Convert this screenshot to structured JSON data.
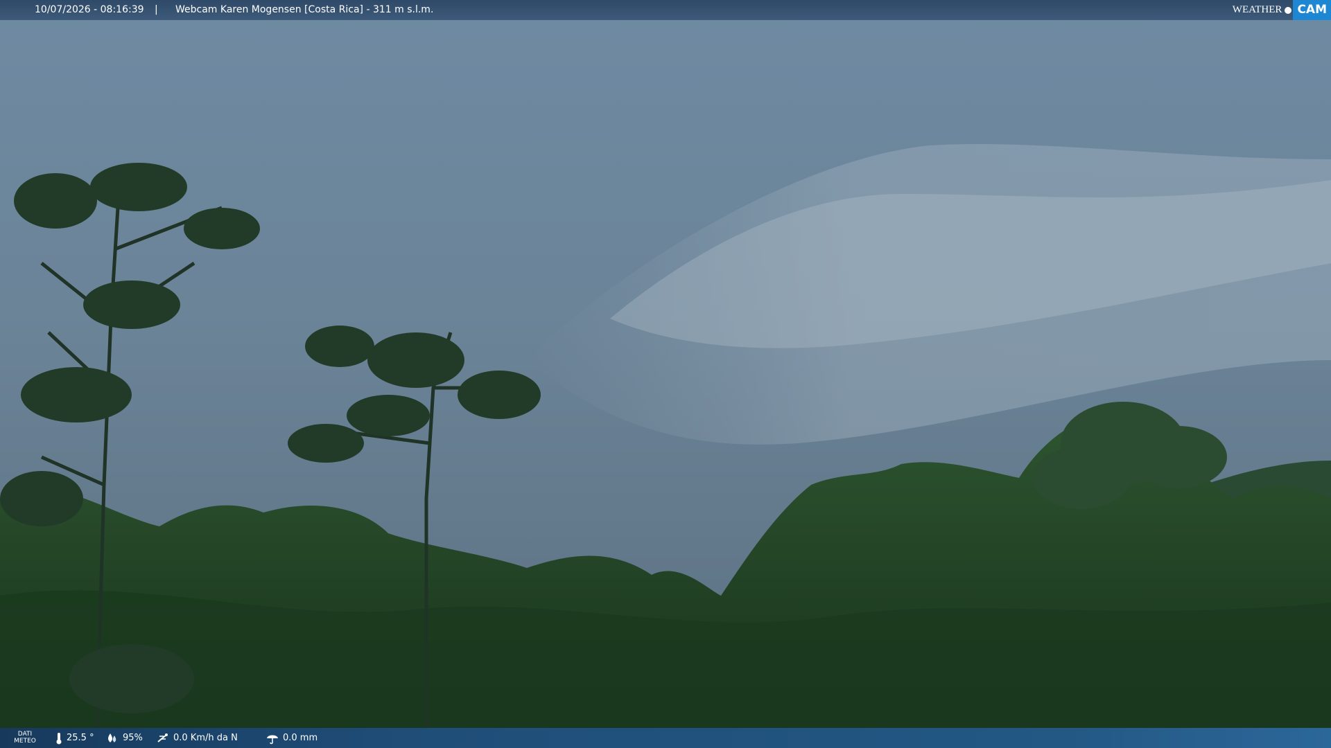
{
  "header": {
    "timestamp": "10/07/2026 - 08:16:39",
    "separator": "|",
    "title": "Webcam Karen Mogensen [Costa Rica] - 311 m s.l.m.",
    "logo_left": "WEATHER",
    "logo_right": "CAM"
  },
  "footer": {
    "dati_label_1": "DATI",
    "dati_label_2": "METEO",
    "temperature": "25.5 °",
    "humidity": "95%",
    "wind": "0.0 Km/h da N",
    "rain": "0.0 mm"
  },
  "icons": [
    "thermometer-icon",
    "humidity-drop-icon",
    "wind-icon",
    "rain-umbrella-icon"
  ],
  "colors": {
    "accent": "#1e87d4",
    "bar": "#2f4a68",
    "sky": "#6d879c",
    "forest": "#22401f"
  }
}
